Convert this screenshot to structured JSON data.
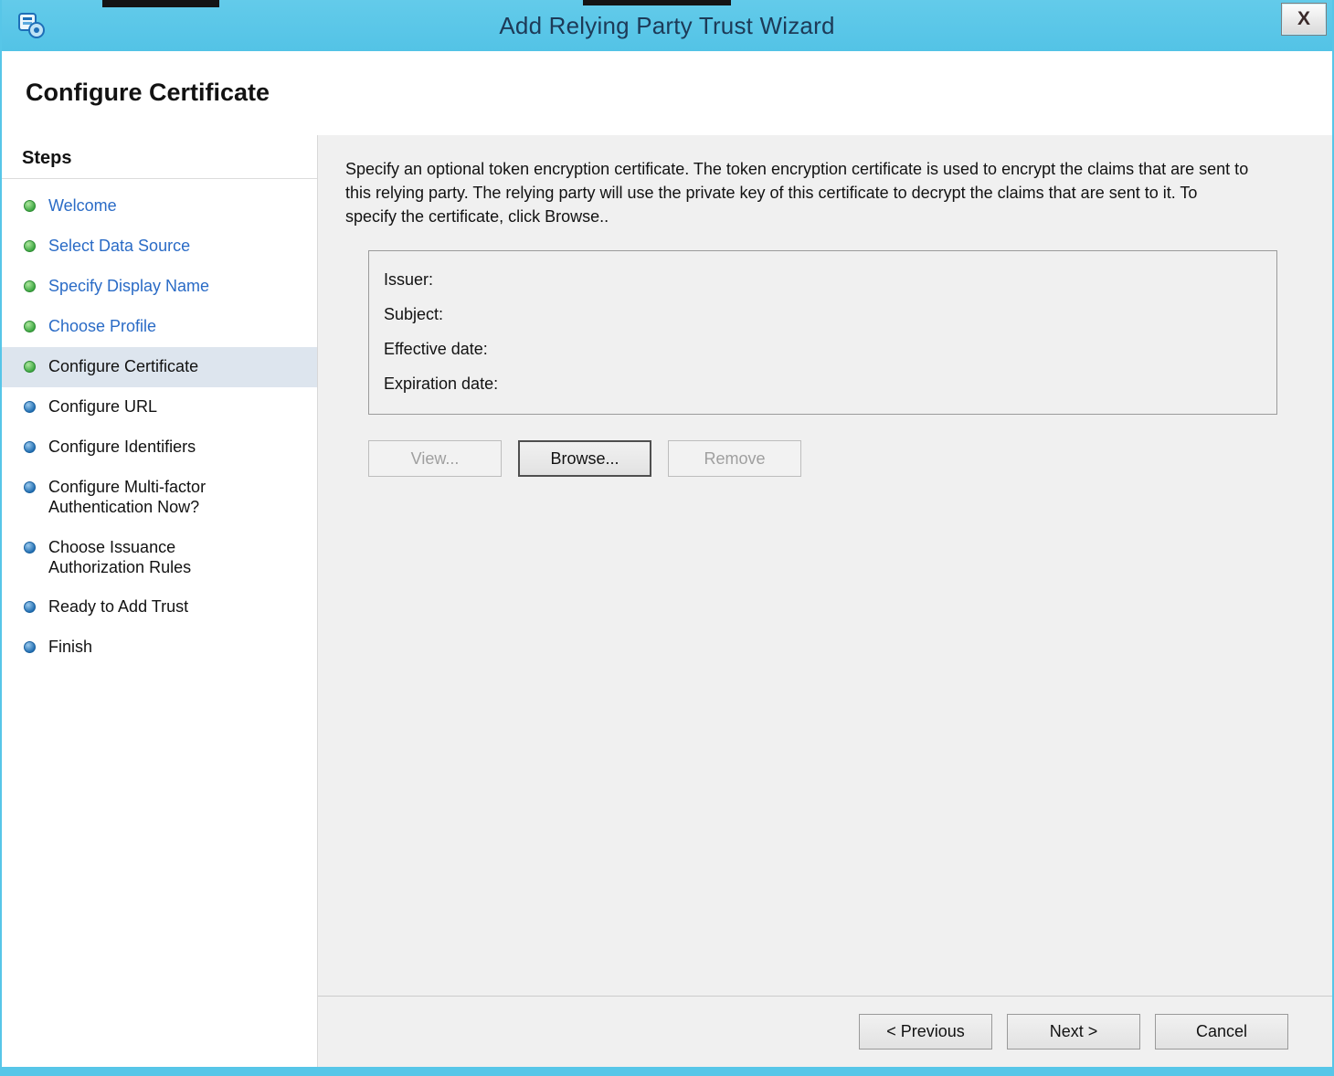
{
  "window": {
    "title": "Add Relying Party Trust Wizard",
    "close_label": "X"
  },
  "header": {
    "title": "Configure Certificate"
  },
  "sidebar": {
    "title": "Steps",
    "items": [
      {
        "label": "Welcome",
        "state": "done"
      },
      {
        "label": "Select Data Source",
        "state": "done"
      },
      {
        "label": "Specify Display Name",
        "state": "done"
      },
      {
        "label": "Choose Profile",
        "state": "done"
      },
      {
        "label": "Configure Certificate",
        "state": "current"
      },
      {
        "label": "Configure URL",
        "state": "pending"
      },
      {
        "label": "Configure Identifiers",
        "state": "pending"
      },
      {
        "label": "Configure Multi-factor Authentication Now?",
        "state": "pending"
      },
      {
        "label": "Choose Issuance Authorization Rules",
        "state": "pending"
      },
      {
        "label": "Ready to Add Trust",
        "state": "pending"
      },
      {
        "label": "Finish",
        "state": "pending"
      }
    ]
  },
  "content": {
    "description": "Specify an optional token encryption certificate.  The token encryption certificate is used to encrypt the claims that are sent to this relying party.  The relying party will use the private key of this certificate to decrypt the claims that are sent to it.  To specify the certificate, click Browse..",
    "certificate": {
      "fields": [
        "Issuer:",
        "Subject:",
        "Effective date:",
        "Expiration date:"
      ]
    },
    "buttons": {
      "view": "View...",
      "browse": "Browse...",
      "remove": "Remove"
    }
  },
  "footer": {
    "previous": "< Previous",
    "next": "Next >",
    "cancel": "Cancel"
  },
  "colors": {
    "titlebar": "#57c6e8",
    "link": "#2a6bc6",
    "step_done": "#3aa63f",
    "step_pending": "#1e6cb0",
    "content_bg": "#f0f0f0",
    "highlight_row": "#dde5ee"
  }
}
